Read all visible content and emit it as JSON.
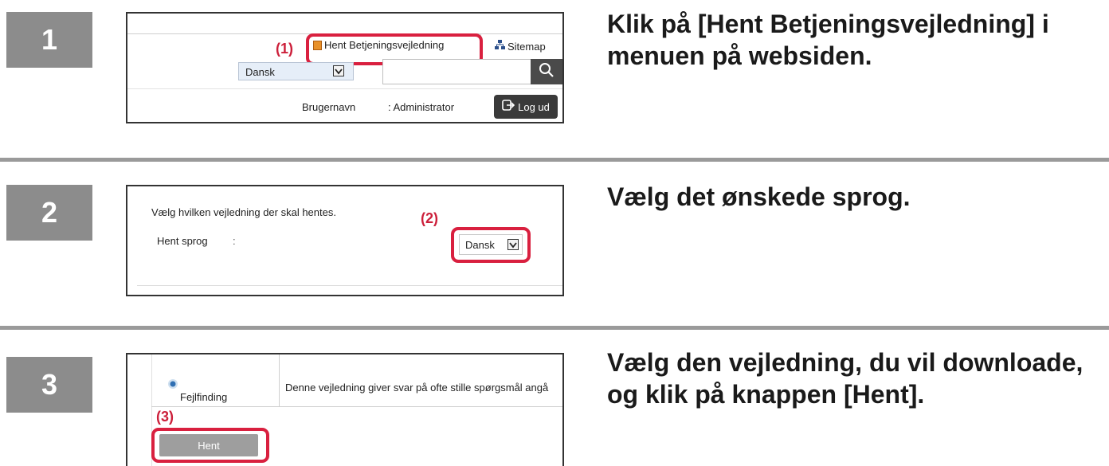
{
  "steps": [
    {
      "number": "1",
      "instruction": "Klik på [Hent Betjeningsvejledning] i menuen på websiden.",
      "panel": {
        "callout": "(1)",
        "menu_link": "Hent Betjeningsvejledning",
        "sitemap_link": "Sitemap",
        "language_select": "Dansk",
        "search_placeholder": "",
        "user_label": "Brugernavn",
        "user_value": ": Administrator",
        "logout_label": "Log ud"
      }
    },
    {
      "number": "2",
      "instruction": "Vælg det ønskede sprog.",
      "panel": {
        "callout": "(2)",
        "prompt": "Vælg hvilken vejledning der skal hentes.",
        "language_label": "Hent sprog",
        "colon": ":",
        "language_select": "Dansk"
      }
    },
    {
      "number": "3",
      "instruction": "Vælg den vejledning, du vil downloade, og klik på knappen [Hent].",
      "panel": {
        "callout": "(3)",
        "row_name": "Fejlfinding",
        "row_desc": "Denne vejledning giver svar på ofte stille spørgsmål angå",
        "download_button": "Hent"
      }
    }
  ],
  "colors": {
    "badge": "#8c8c8c",
    "callout": "#d9203f",
    "logout_bg": "#3a3a3a",
    "language_select_bg": "#e6eef8"
  }
}
